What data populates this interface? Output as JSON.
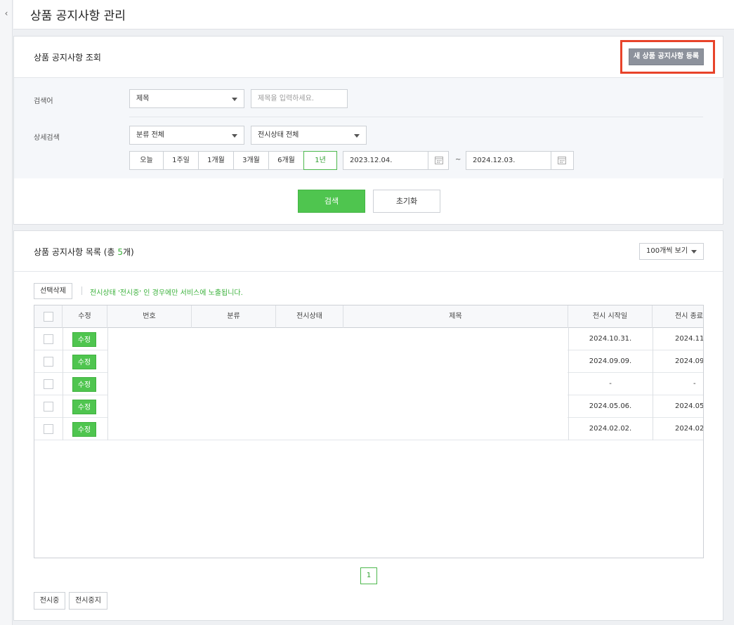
{
  "nav": {
    "collapse_glyph": "‹",
    "collapse_icon": "chevron-left-icon"
  },
  "header": {
    "title": "상품 공지사항 관리"
  },
  "search_panel": {
    "title": "상품 공지사항 조회",
    "new_button": "새 상품 공지사항 등록",
    "keyword_label": "검색어",
    "keyword_type": "제목",
    "keyword_placeholder": "제목을 입력하세요.",
    "detail_label": "상세검색",
    "category_select": "분류 전체",
    "status_select": "전시상태 전체",
    "periods": [
      "오늘",
      "1주일",
      "1개월",
      "3개월",
      "6개월",
      "1년"
    ],
    "active_period": "1년",
    "date_from": "2023.12.04.",
    "date_to": "2024.12.03.",
    "date_sep": "~",
    "search_button": "검색",
    "reset_button": "초기화"
  },
  "list_panel": {
    "title_prefix": "상품 공지사항 목록 (총 ",
    "count": "5",
    "title_suffix": "개)",
    "page_size": "100개씩 보기",
    "delete_button": "선택삭제",
    "notice": "전시상태 '전시중' 인 경우에만 서비스에 노출됩니다.",
    "columns": [
      "수정",
      "번호",
      "분류",
      "전시상태",
      "제목",
      "전시 시작일",
      "전시 종료"
    ],
    "edit_label": "수정",
    "rows": [
      {
        "start": "2024.10.31.",
        "end": "2024.11."
      },
      {
        "start": "2024.09.09.",
        "end": "2024.09."
      },
      {
        "start": "-",
        "end": "-"
      },
      {
        "start": "2024.05.06.",
        "end": "2024.05."
      },
      {
        "start": "2024.02.02.",
        "end": "2024.02."
      }
    ],
    "page": "1",
    "display_on_button": "전시중",
    "display_off_button": "전시중지"
  },
  "colors": {
    "accent_green": "#4fc54f",
    "highlight_red": "#e8432a",
    "button_gray": "#8d929c"
  }
}
